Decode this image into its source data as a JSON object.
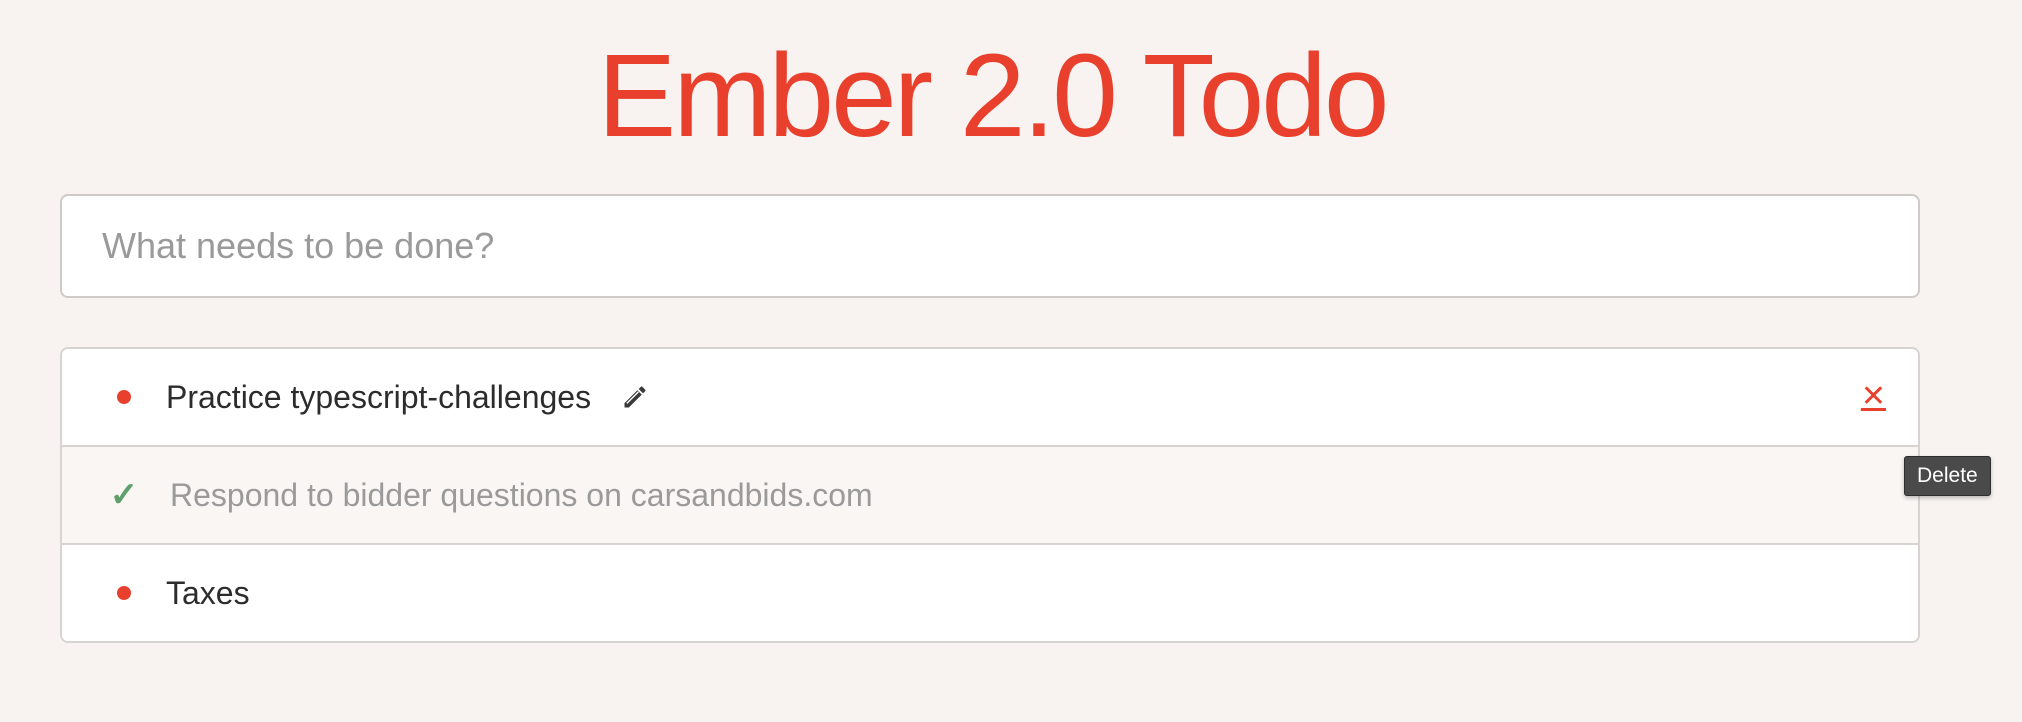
{
  "header": {
    "title": "Ember 2.0 Todo"
  },
  "new_todo": {
    "placeholder": "What needs to be done?",
    "value": ""
  },
  "todos": [
    {
      "label": "Practice typescript-challenges",
      "completed": false,
      "status_icon": "red-dot-icon",
      "show_edit": true,
      "show_delete": true,
      "delete_label": "✕"
    },
    {
      "label": "Respond to bidder questions on carsandbids.com",
      "completed": true,
      "status_icon": "checkmark-icon",
      "check_glyph": "✓"
    },
    {
      "label": "Taxes",
      "completed": false,
      "status_icon": "red-dot-icon"
    }
  ],
  "tooltip": {
    "text": "Delete"
  },
  "colors": {
    "accent": "#e8402c",
    "background": "#f8f3f0",
    "completed_check": "#5fa06a",
    "completed_text": "#9a9a9a"
  }
}
